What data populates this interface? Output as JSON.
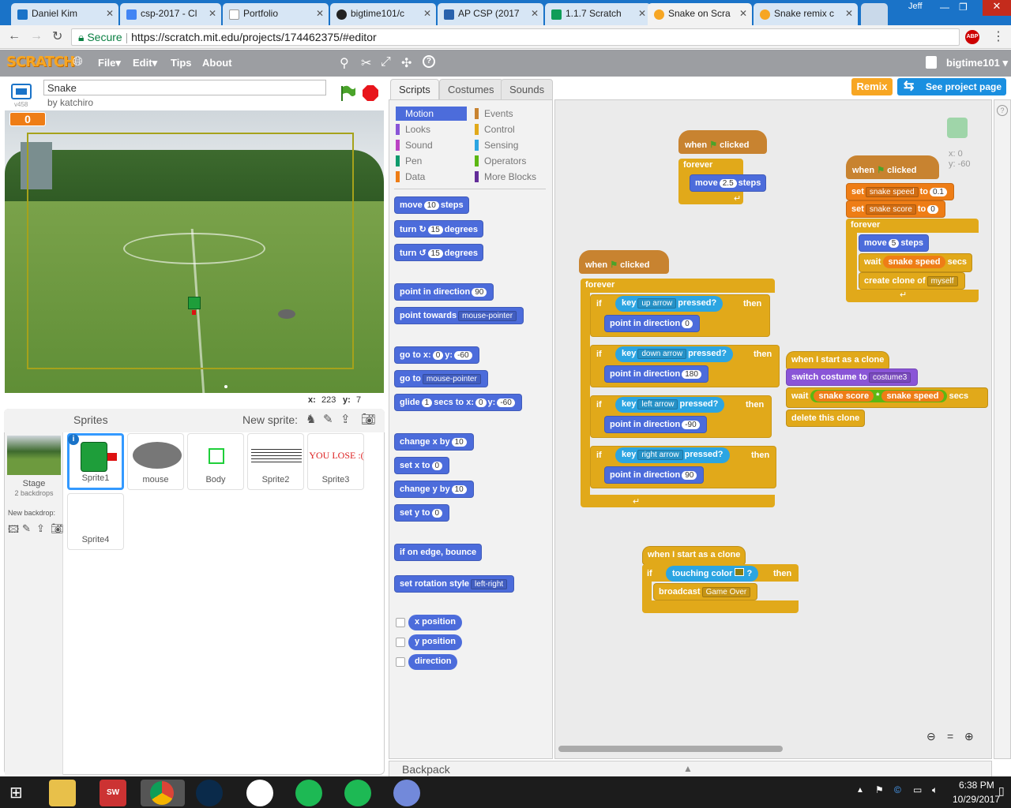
{
  "browser": {
    "user": "Jeff",
    "tabs": [
      {
        "label": "Daniel Kim"
      },
      {
        "label": "csp-2017 - Cl"
      },
      {
        "label": "Portfolio"
      },
      {
        "label": "bigtime101/c"
      },
      {
        "label": "AP CSP (2017"
      },
      {
        "label": "1.1.7 Scratch"
      },
      {
        "label": "Snake on Scra"
      },
      {
        "label": "Snake remix c"
      }
    ],
    "secure_label": "Secure",
    "url": "https://scratch.mit.edu/projects/174462375/#editor"
  },
  "menubar": {
    "logo": "SCRATCH",
    "file": "File",
    "edit": "Edit",
    "tips": "Tips",
    "about": "About",
    "username": "bigtime101"
  },
  "project": {
    "title": "Snake",
    "author": "by katchiro",
    "version": "v458",
    "score": "0",
    "remix": "Remix",
    "see_project": "See project page"
  },
  "stage": {
    "x_label": "x:",
    "x_value": "223",
    "y_label": "y:",
    "y_value": "7"
  },
  "sprites": {
    "header": "Sprites",
    "new_sprite": "New sprite:",
    "stage_label": "Stage",
    "stage_sub": "2 backdrops",
    "new_backdrop": "New backdrop:",
    "items": [
      {
        "name": "Sprite1"
      },
      {
        "name": "mouse"
      },
      {
        "name": "Body"
      },
      {
        "name": "Sprite2"
      },
      {
        "name": "Sprite3"
      },
      {
        "name": "Sprite4"
      }
    ],
    "sprite3_text": "YOU LOSE :("
  },
  "editor_tabs": {
    "scripts": "Scripts",
    "costumes": "Costumes",
    "sounds": "Sounds"
  },
  "categories": [
    {
      "label": "Motion",
      "color": "#4c6cdb"
    },
    {
      "label": "Events",
      "color": "#c88330"
    },
    {
      "label": "Looks",
      "color": "#8a55d7"
    },
    {
      "label": "Control",
      "color": "#e1a91a"
    },
    {
      "label": "Sound",
      "color": "#bb42c3"
    },
    {
      "label": "Sensing",
      "color": "#2ca5e2"
    },
    {
      "label": "Pen",
      "color": "#0e9a6c"
    },
    {
      "label": "Operators",
      "color": "#5cb712"
    },
    {
      "label": "Data",
      "color": "#ee7d16"
    },
    {
      "label": "More Blocks",
      "color": "#632d99"
    }
  ],
  "palette": {
    "move": "move",
    "move_n": "10",
    "steps": "steps",
    "turn": "turn",
    "turn_n": "15",
    "degrees": "degrees",
    "point_dir": "point in direction",
    "dir_n": "90",
    "point_towards": "point towards",
    "mouse_pointer": "mouse-pointer",
    "goto_xy": "go to x:",
    "y": "y:",
    "gx": "0",
    "gy": "-60",
    "goto": "go to",
    "glide": "glide",
    "glide_n": "1",
    "secs_to_x": "secs to x:",
    "change_x": "change x by",
    "cx": "10",
    "set_x": "set x to",
    "sx": "0",
    "change_y": "change y by",
    "cy": "10",
    "set_y": "set y to",
    "sy": "0",
    "bounce": "if on edge, bounce",
    "rotation": "set rotation style",
    "rot_val": "left-right",
    "x_position": "x position",
    "y_position": "y position",
    "direction": "direction"
  },
  "scripts": {
    "when": "when",
    "clicked": "clicked",
    "forever": "forever",
    "s1_move": "move",
    "s1_move_n": "2.5",
    "steps": "steps",
    "s2_if": "if",
    "key": "key",
    "pressed": "pressed?",
    "then": "then",
    "up_arrow": "up arrow",
    "down_arrow": "down arrow",
    "left_arrow": "left arrow",
    "right_arrow": "right arrow",
    "point_in_direction": "point in direction",
    "dir0": "0",
    "dir180": "180",
    "dirm90": "-90",
    "dir90": "90",
    "set": "set",
    "to": "to",
    "snake_speed": "snake speed",
    "snake_score": "snake score",
    "speed_val": "0.1",
    "score_val": "0",
    "move5": "5",
    "wait": "wait",
    "secs": "secs",
    "create_clone": "create clone of",
    "myself": "myself",
    "clone_start": "when I start as a clone",
    "switch_costume": "switch costume to",
    "costume3": "costume3",
    "times": "*",
    "delete_clone": "delete this clone",
    "touching_color": "touching color",
    "q": "?",
    "broadcast": "broadcast",
    "game_over": "Game Over",
    "sprite_x": "x: 0",
    "sprite_y": "y: -60"
  },
  "backpack": "Backpack",
  "taskbar": {
    "time": "6:38 PM",
    "date": "10/29/2017"
  }
}
